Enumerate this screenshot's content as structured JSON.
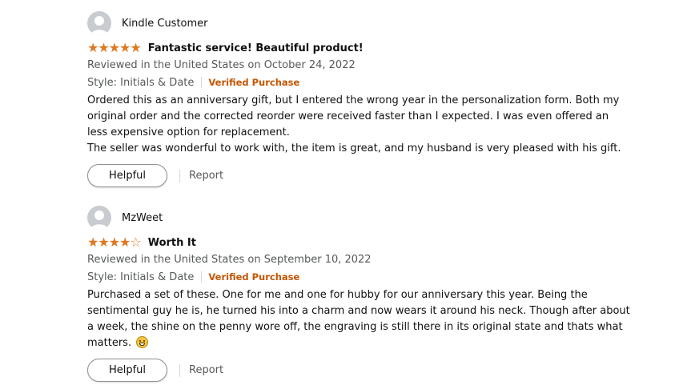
{
  "reviews": [
    {
      "profile_name": "Kindle Customer",
      "rating": 5,
      "stars": [
        "★",
        "★",
        "★",
        "★",
        "★"
      ],
      "title": "Fantastic service! Beautiful product!",
      "date": "Reviewed in the United States on October 24, 2022",
      "style": "Style: Initials & Date",
      "verified": "Verified Purchase",
      "body": [
        "Ordered this as an anniversary gift, but I entered the wrong year in the personalization form. Both my original order and the corrected reorder were received faster than I expected. I was even offered an less expensive option for replacement.",
        "The seller was wonderful to work with, the item is great, and my husband is very pleased with his gift."
      ],
      "helpful_label": "Helpful",
      "report_label": "Report"
    },
    {
      "profile_name": "MzWeet",
      "rating": 4,
      "stars": [
        "★",
        "★",
        "★",
        "★",
        "☆"
      ],
      "title": "Worth It",
      "date": "Reviewed in the United States on September 10, 2022",
      "style": "Style: Initials & Date",
      "verified": "Verified Purchase",
      "body": [
        "Purchased a set of these. One for me and one for hubby for our anniversary this year. Being the sentimental guy he is, he turned his into a charm and now wears it around his neck. Though after about a week, the shine on the penny wore off, the engraving is still there in its original state and thats what matters."
      ],
      "body_emoji": "grinning-face-emoji",
      "helpful_label": "Helpful",
      "report_label": "Report"
    }
  ],
  "colors": {
    "star": "#de7921",
    "verified": "#c45500",
    "secondary_text": "#565959"
  }
}
